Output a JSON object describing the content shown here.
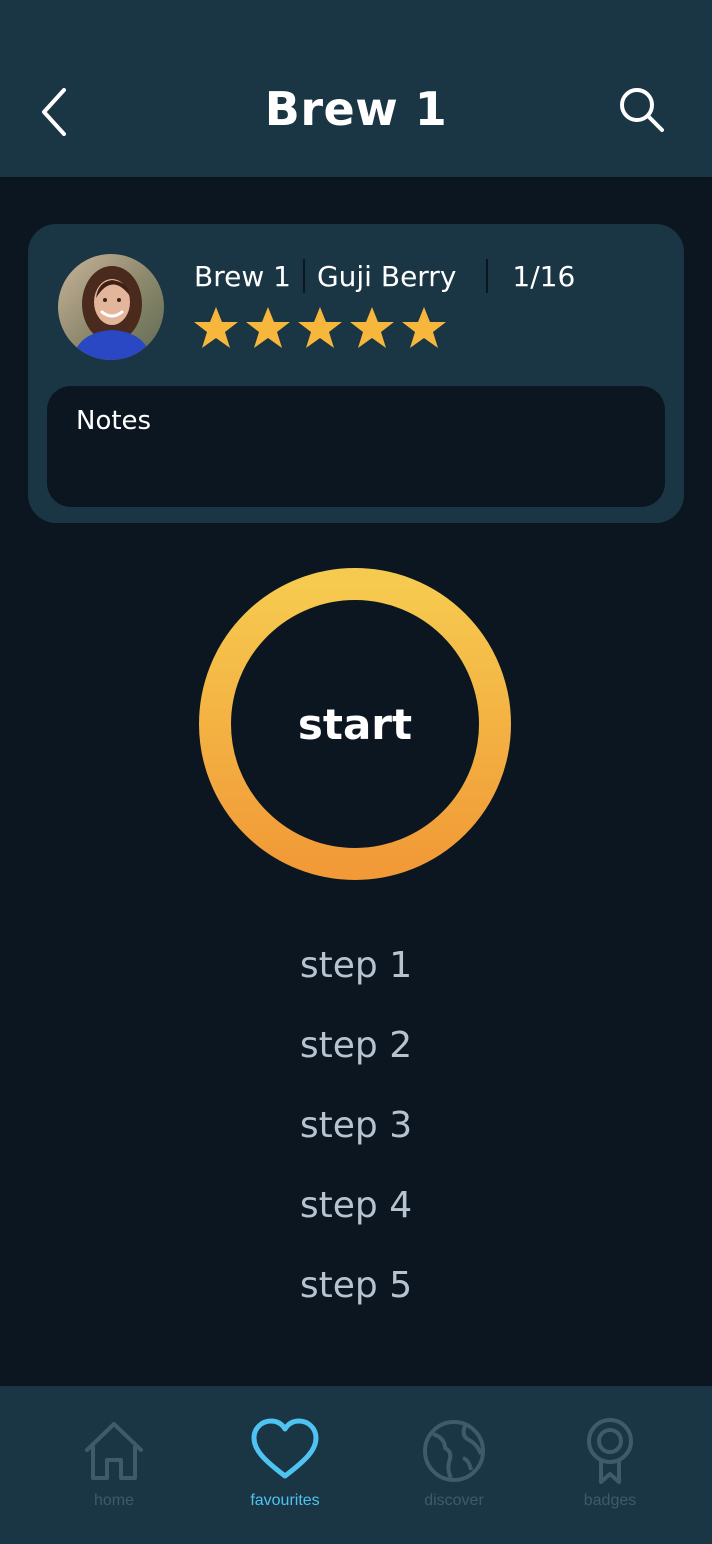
{
  "header": {
    "title": "Brew 1",
    "back_icon": "chevron-left-icon",
    "search_icon": "search-icon"
  },
  "card": {
    "brew_name": "Brew 1",
    "bean": "Guji Berry",
    "progress": "1/16",
    "rating": 5,
    "rating_max": 5,
    "notes_placeholder": "Notes"
  },
  "start": {
    "label": "start"
  },
  "steps": [
    "step 1",
    "step 2",
    "step 3",
    "step 4",
    "step 5"
  ],
  "nav": {
    "items": [
      {
        "label": "home",
        "icon": "home-icon"
      },
      {
        "label": "favourites",
        "icon": "heart-icon",
        "active": true
      },
      {
        "label": "discover",
        "icon": "globe-icon"
      },
      {
        "label": "badges",
        "icon": "badge-icon"
      }
    ]
  },
  "colors": {
    "background": "#0b1620",
    "panel": "#1a3543",
    "accent_gold_top": "#f6ca4f",
    "accent_gold_bottom": "#f19a37",
    "star": "#f6b73c",
    "nav_active": "#4fc3f2",
    "nav_inactive": "#3f5a69"
  }
}
